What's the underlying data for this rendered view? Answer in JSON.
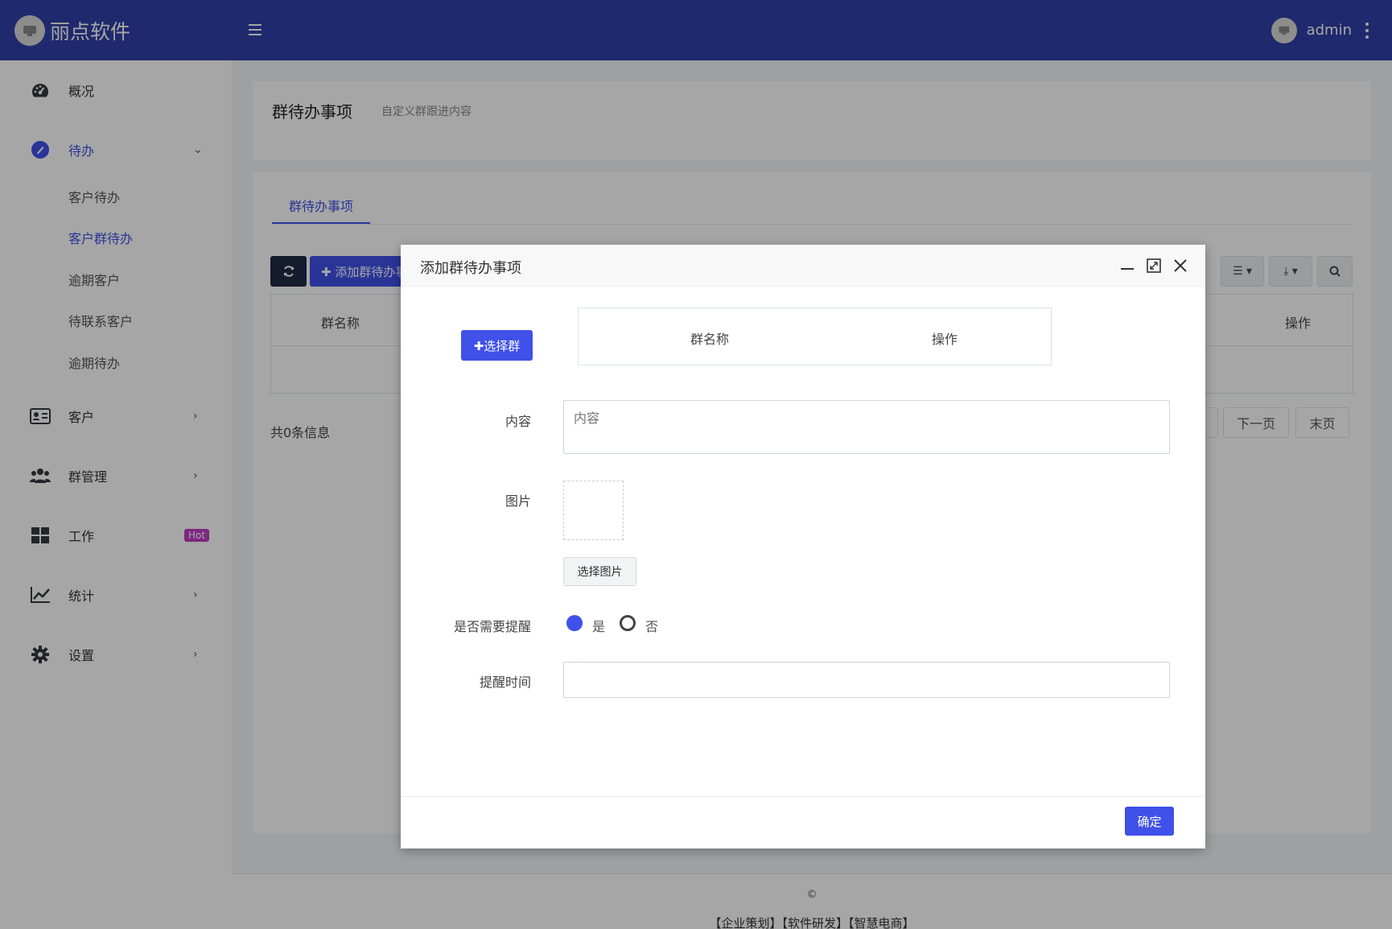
{
  "app": {
    "brand_name": "丽点软件",
    "user_name": "admin"
  },
  "sidebar": {
    "items": [
      {
        "label": "概况",
        "icon": "dashboard-icon"
      },
      {
        "label": "待办",
        "icon": "todo-icon"
      },
      {
        "label": "客户",
        "icon": "contact-card-icon"
      },
      {
        "label": "群管理",
        "icon": "users-icon"
      },
      {
        "label": "工作",
        "icon": "grid-icon",
        "badge": "Hot"
      },
      {
        "label": "统计",
        "icon": "chart-line-icon"
      },
      {
        "label": "设置",
        "icon": "gear-icon"
      }
    ],
    "sub_items": [
      "客户待办",
      "客户群待办",
      "逾期客户",
      "待联系客户",
      "逾期待办"
    ]
  },
  "page": {
    "title": "群待办事项",
    "subtitle": "自定义群跟进内容"
  },
  "tabs": [
    "群待办事项"
  ],
  "toolbar": {
    "add_label": "✚ 添加群待办事项"
  },
  "table": {
    "headers": [
      "群名称",
      "操作"
    ]
  },
  "pagination": {
    "total": "共0条信息",
    "next": "下一页",
    "last": "末页"
  },
  "footer": {
    "copyright": "©",
    "links": "【企业策划】【软件研发】【智慧电商】"
  },
  "modal": {
    "title": "添加群待办事项",
    "select_group_label": "✚选择群",
    "group_table_headers": [
      "群名称",
      "操作"
    ],
    "content_label": "内容",
    "content_placeholder": "内容",
    "image_label": "图片",
    "choose_image_label": "选择图片",
    "remind_label": "是否需要提醒",
    "remind_options": [
      "是",
      "否"
    ],
    "remind_selected": "是",
    "remind_time_label": "提醒时间",
    "remind_time_value": "",
    "ok_label": "确定"
  },
  "colors": {
    "header_bg": "#303fa8",
    "accent": "#3f51e8",
    "hot_badge": "#c03cc6"
  }
}
